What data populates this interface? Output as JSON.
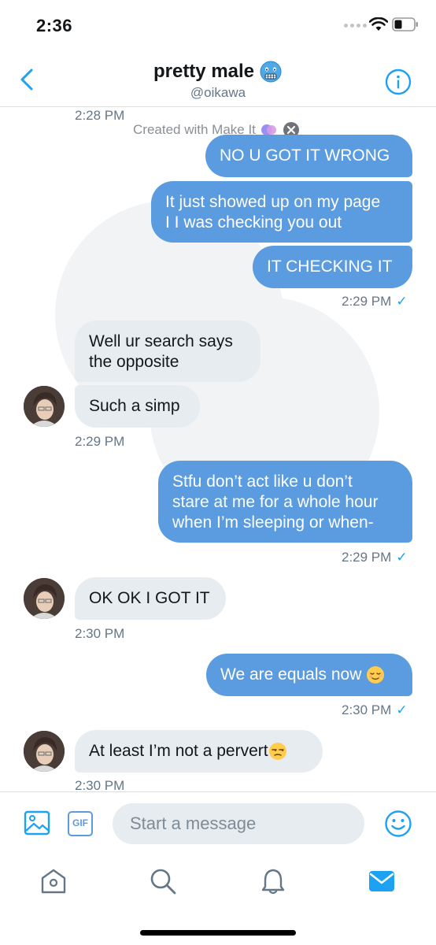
{
  "status_bar": {
    "time": "2:36"
  },
  "header": {
    "name": "pretty male",
    "name_emoji": "cold-face-emoji",
    "handle": "@oikawa"
  },
  "watermark": {
    "label": "Created with Make It"
  },
  "messages": {
    "t0": "2:28 PM",
    "m1": "NO U GOT IT WRONG",
    "m2_line1": "It just showed up on my page",
    "m2_line2": "I I was checking you out",
    "m3": "IT CHECKING IT",
    "t1": "2:29 PM",
    "m4_line1": "Well ur search says",
    "m4_line2": "the opposite",
    "m5": "Such a simp",
    "t2": "2:29 PM",
    "m6_line1": "Stfu don’t act like u don’t",
    "m6_line2": "stare at me for a whole hour",
    "m6_line3": "when I’m sleeping or when-",
    "t3": "2:29 PM",
    "m7": "OK OK I GOT IT",
    "t4": "2:30 PM",
    "m8": "We are equals now",
    "m8_emoji": "relieved-face-emoji",
    "t5": "2:30 PM",
    "m9": "At least I’m not a pervert",
    "m9_emoji": "unamused-face-emoji",
    "t6": "2:30 PM",
    "check": "✓"
  },
  "composer": {
    "placeholder": "Start a message",
    "gif_label": "GIF"
  },
  "colors": {
    "accent": "#1da1f2",
    "bubble_out": "#5b9bdf",
    "bubble_in": "#e6ecf0",
    "meta_text": "#657786"
  }
}
